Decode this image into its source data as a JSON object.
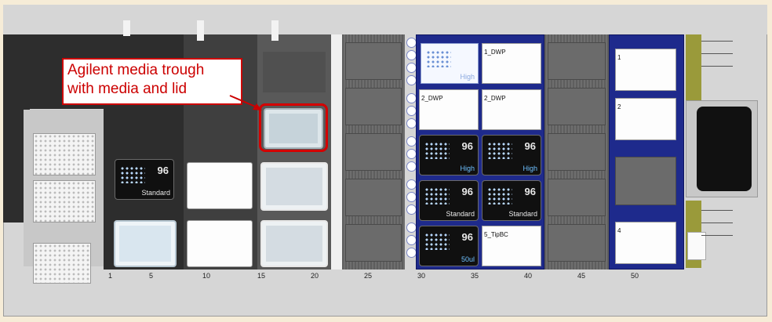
{
  "callout": {
    "line1": "Agilent media trough",
    "line2": "with media and lid"
  },
  "ruler": [
    "1",
    "5",
    "10",
    "15",
    "20",
    "25",
    "30",
    "35",
    "40",
    "45",
    "50"
  ],
  "tip_racks": {
    "standard_left": {
      "count": "96",
      "type": "Standard"
    },
    "high_top": {
      "count": "",
      "type": "High"
    },
    "high_1": {
      "count": "96",
      "type": "High"
    },
    "high_2": {
      "count": "96",
      "type": "High"
    },
    "std_1": {
      "count": "96",
      "type": "Standard"
    },
    "std_2": {
      "count": "96",
      "type": "Standard"
    },
    "ul50": {
      "count": "96",
      "type": "50ul"
    }
  },
  "plates": {
    "dwp_1": "1_DWP",
    "dwp_2a": "2_DWP",
    "dwp_2b": "2_DWP",
    "tipbc_5": "5_TipBC"
  },
  "right_positions": [
    "1",
    "2",
    "4"
  ],
  "colors": {
    "callout": "#cc0000",
    "blue_carrier": "#1e2a8c"
  }
}
